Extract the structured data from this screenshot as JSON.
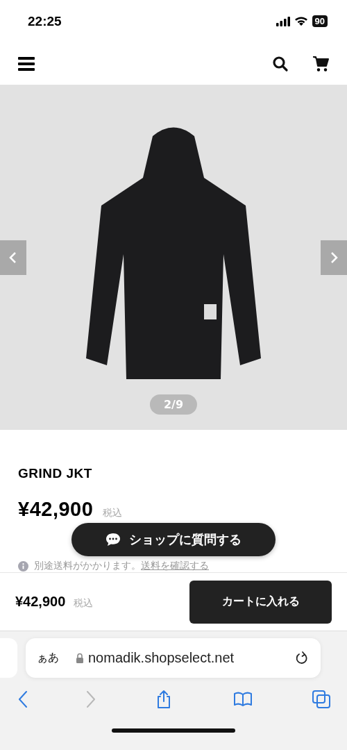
{
  "status_bar": {
    "time": "22:25",
    "battery": "90"
  },
  "gallery": {
    "counter": "2/9"
  },
  "product": {
    "name": "GRIND JKT",
    "price": "¥42,900",
    "tax_note": "税込",
    "shipping_note": "別途送料がかかります。",
    "shipping_link": "送料を確認する"
  },
  "chat_button": {
    "label": "ショップに質問する"
  },
  "purchase_bar": {
    "price": "¥42,900",
    "tax_note": "税込",
    "button": "カートに入れる"
  },
  "browser": {
    "text_size": "ぁあ",
    "url": "nomadik.shopselect.net",
    "toolbar": [
      {
        "kind": "back",
        "disabled": false
      },
      {
        "kind": "forward",
        "disabled": true
      },
      {
        "kind": "share",
        "disabled": false
      },
      {
        "kind": "bookmarks",
        "disabled": false
      },
      {
        "kind": "tabs",
        "disabled": false
      }
    ]
  }
}
